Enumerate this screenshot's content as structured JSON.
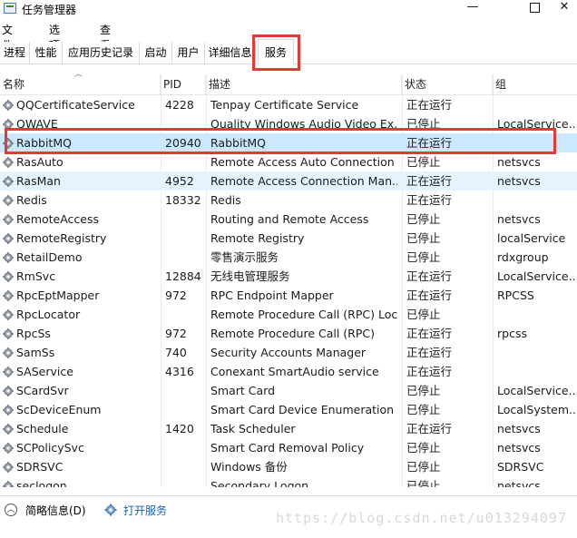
{
  "window": {
    "title": "任务管理器",
    "minimize": "—",
    "close": "✕"
  },
  "menu": [
    "文件(F)",
    "选项(O)",
    "查看(V)"
  ],
  "tabs": [
    "进程",
    "性能",
    "应用历史记录",
    "启动",
    "用户",
    "详细信息",
    "服务"
  ],
  "active_tab": "服务",
  "columns": {
    "name": "名称",
    "pid": "PID",
    "desc": "描述",
    "status": "状态",
    "group": "组"
  },
  "rows": [
    {
      "name": "QQCertificateService",
      "pid": "4228",
      "desc": "Tenpay Certificate Service",
      "status": "正在运行",
      "group": ""
    },
    {
      "name": "QWAVE",
      "pid": "",
      "desc": "Quality Windows Audio Video Ex...",
      "status": "已停止",
      "group": "LocalService..."
    },
    {
      "name": "RabbitMQ",
      "pid": "20940",
      "desc": "RabbitMQ",
      "status": "正在运行",
      "group": ""
    },
    {
      "name": "RasAuto",
      "pid": "",
      "desc": "Remote Access Auto Connection ...",
      "status": "已停止",
      "group": "netsvcs"
    },
    {
      "name": "RasMan",
      "pid": "4952",
      "desc": "Remote Access Connection Man...",
      "status": "正在运行",
      "group": "netsvcs"
    },
    {
      "name": "Redis",
      "pid": "18332",
      "desc": "Redis",
      "status": "正在运行",
      "group": ""
    },
    {
      "name": "RemoteAccess",
      "pid": "",
      "desc": "Routing and Remote Access",
      "status": "已停止",
      "group": "netsvcs"
    },
    {
      "name": "RemoteRegistry",
      "pid": "",
      "desc": "Remote Registry",
      "status": "已停止",
      "group": "localService"
    },
    {
      "name": "RetailDemo",
      "pid": "",
      "desc": "零售演示服务",
      "status": "已停止",
      "group": "rdxgroup"
    },
    {
      "name": "RmSvc",
      "pid": "12884",
      "desc": "无线电管理服务",
      "status": "正在运行",
      "group": "LocalService..."
    },
    {
      "name": "RpcEptMapper",
      "pid": "972",
      "desc": "RPC Endpoint Mapper",
      "status": "正在运行",
      "group": "RPCSS"
    },
    {
      "name": "RpcLocator",
      "pid": "",
      "desc": "Remote Procedure Call (RPC) Loc...",
      "status": "已停止",
      "group": ""
    },
    {
      "name": "RpcSs",
      "pid": "972",
      "desc": "Remote Procedure Call (RPC)",
      "status": "正在运行",
      "group": "rpcss"
    },
    {
      "name": "SamSs",
      "pid": "740",
      "desc": "Security Accounts Manager",
      "status": "正在运行",
      "group": ""
    },
    {
      "name": "SAService",
      "pid": "4316",
      "desc": "Conexant SmartAudio service",
      "status": "正在运行",
      "group": ""
    },
    {
      "name": "SCardSvr",
      "pid": "",
      "desc": "Smart Card",
      "status": "已停止",
      "group": "LocalService..."
    },
    {
      "name": "ScDeviceEnum",
      "pid": "",
      "desc": "Smart Card Device Enumeration ...",
      "status": "已停止",
      "group": "LocalSystem..."
    },
    {
      "name": "Schedule",
      "pid": "1420",
      "desc": "Task Scheduler",
      "status": "正在运行",
      "group": "netsvcs"
    },
    {
      "name": "SCPolicySvc",
      "pid": "",
      "desc": "Smart Card Removal Policy",
      "status": "已停止",
      "group": "netsvcs"
    },
    {
      "name": "SDRSVC",
      "pid": "",
      "desc": "Windows 备份",
      "status": "已停止",
      "group": "SDRSVC"
    },
    {
      "name": "seclogon",
      "pid": "",
      "desc": "Secondary Logon",
      "status": "已停止",
      "group": "netsvcs"
    }
  ],
  "selected_row": "RabbitMQ",
  "hover_row": "RasMan",
  "footer": {
    "fewer_details": "简略信息(D)",
    "open_services": "打开服务"
  },
  "watermark": "https://blog.csdn.net/u013294097",
  "colors": {
    "highlight_box": "#e53935",
    "selected_row": "#cce8ff",
    "hover_row": "#e5f3ff",
    "link": "#1a5fb4"
  }
}
